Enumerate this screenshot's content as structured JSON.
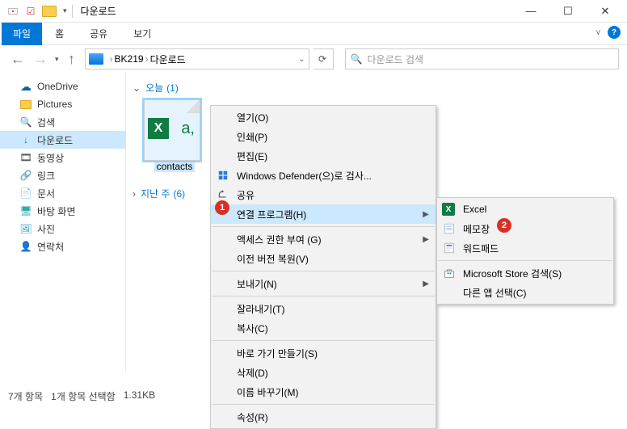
{
  "window": {
    "title": "다운로드",
    "controls": {
      "minimize": "—",
      "maximize": "☐",
      "close": "✕"
    }
  },
  "ribbon": {
    "file": "파일",
    "tabs": [
      "홈",
      "공유",
      "보기"
    ]
  },
  "nav": {
    "back": "←",
    "forward": "→",
    "up": "↑",
    "breadcrumb": {
      "part1": "BK219",
      "part2": "다운로드"
    },
    "refresh": "⟳",
    "search_placeholder": "다운로드 검색"
  },
  "sidebar": {
    "items": [
      {
        "label": "OneDrive",
        "icon": "cloud"
      },
      {
        "label": "Pictures",
        "icon": "folder"
      },
      {
        "label": "검색",
        "icon": "search"
      },
      {
        "label": "다운로드",
        "icon": "download",
        "selected": true
      },
      {
        "label": "동영상",
        "icon": "video"
      },
      {
        "label": "링크",
        "icon": "link"
      },
      {
        "label": "문서",
        "icon": "doc"
      },
      {
        "label": "바탕 화면",
        "icon": "desktop"
      },
      {
        "label": "사진",
        "icon": "photo"
      },
      {
        "label": "연락처",
        "icon": "contacts"
      }
    ]
  },
  "content": {
    "group_today": {
      "label": "오늘",
      "count": "(1)"
    },
    "group_lastweek": {
      "label": "지난 주",
      "count": "(6)"
    },
    "file": {
      "name": "contacts"
    }
  },
  "status": {
    "total": "7개 항목",
    "selected": "1개 항목 선택함",
    "size": "1.31KB"
  },
  "contextmenu": {
    "items": [
      "열기(O)",
      "인쇄(P)",
      "편집(E)",
      "Windows Defender(으)로 검사...",
      "공유",
      "연결 프로그램(H)",
      "액세스 권한 부여 (G)",
      "이전 버전 복원(V)",
      "보내기(N)",
      "잘라내기(T)",
      "복사(C)",
      "바로 가기 만들기(S)",
      "삭제(D)",
      "이름 바꾸기(M)",
      "속성(R)"
    ]
  },
  "submenu": {
    "items": [
      "Excel",
      "메모장",
      "워드패드",
      "Microsoft Store 검색(S)",
      "다른 앱 선택(C)"
    ]
  },
  "badges": {
    "one": "1",
    "two": "2"
  }
}
